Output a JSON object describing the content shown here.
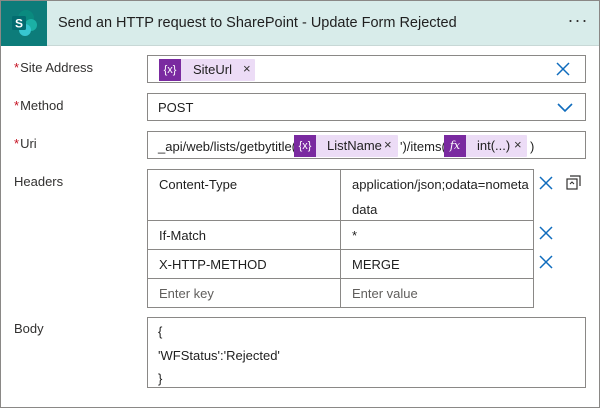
{
  "header": {
    "title": "Send an HTTP request to SharePoint - Update Form Rejected",
    "more_label": "···",
    "app_icon": "sharepoint-icon",
    "colors": {
      "bar": "#d8ecea",
      "icon_bg": "#0d7c7a",
      "token": "#ecdcf6",
      "token_icon": "#7a2aa0",
      "accent": "#0f6cbd",
      "required": "#c50f1f"
    }
  },
  "site_address": {
    "label": "Site Address",
    "required_mark": "*",
    "token": {
      "icon": "{x}",
      "label": "SiteUrl",
      "remove": "×"
    }
  },
  "method": {
    "label": "Method",
    "required_mark": "*",
    "value": "POST"
  },
  "uri": {
    "label": "Uri",
    "required_mark": "*",
    "text1": "_api/web/lists/getbytitle('",
    "token1": {
      "icon": "{x}",
      "label": "ListName",
      "remove": "×"
    },
    "text2": "')/items(",
    "token2": {
      "icon": "fx",
      "label": "int(...)",
      "remove": "×"
    },
    "text3": ")"
  },
  "headers": {
    "label": "Headers",
    "rows": [
      {
        "key": "Content-Type",
        "value_line1": "application/json;odata=nometa",
        "value_line2": "data"
      },
      {
        "key": "If-Match",
        "value": "*"
      },
      {
        "key": "X-HTTP-METHOD",
        "value": "MERGE"
      }
    ],
    "key_placeholder": "Enter key",
    "value_placeholder": "Enter value"
  },
  "body": {
    "label": "Body",
    "lines": [
      "{",
      "'WFStatus':'Rejected'",
      "}"
    ]
  }
}
